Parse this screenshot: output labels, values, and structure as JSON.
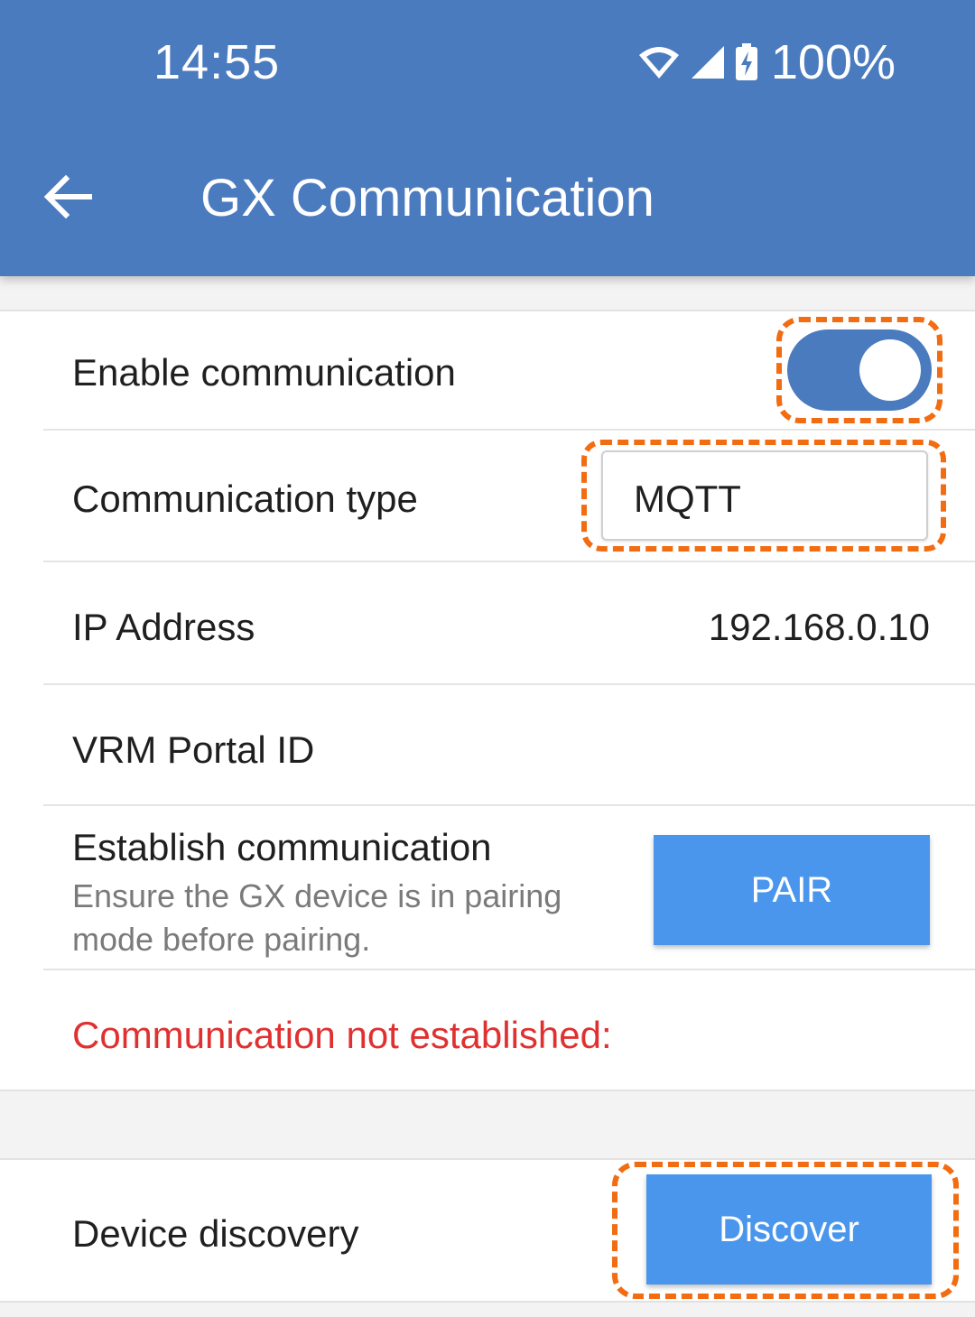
{
  "status_bar": {
    "time": "14:55",
    "battery": "100%",
    "icons": [
      "wifi-icon",
      "cell-signal-icon",
      "battery-charging-icon"
    ]
  },
  "app_bar": {
    "back_icon": "arrow-back-icon",
    "title": "GX Communication"
  },
  "settings": {
    "enable_communication": {
      "label": "Enable communication",
      "enabled": true
    },
    "communication_type": {
      "label": "Communication type",
      "value": "MQTT"
    },
    "ip_address": {
      "label": "IP Address",
      "value": "192.168.0.10"
    },
    "vrm_portal_id": {
      "label": "VRM Portal ID",
      "value": ""
    },
    "establish_communication": {
      "label": "Establish communication",
      "description": "Ensure the GX device is in pairing mode before pairing.",
      "button_label": "PAIR"
    },
    "status_message": "Communication not established:"
  },
  "discovery": {
    "label": "Device discovery",
    "button_label": "Discover"
  },
  "colors": {
    "primary": "#4b7bbf",
    "button": "#4a96ec",
    "error": "#e03131",
    "highlight": "#f26c12"
  }
}
